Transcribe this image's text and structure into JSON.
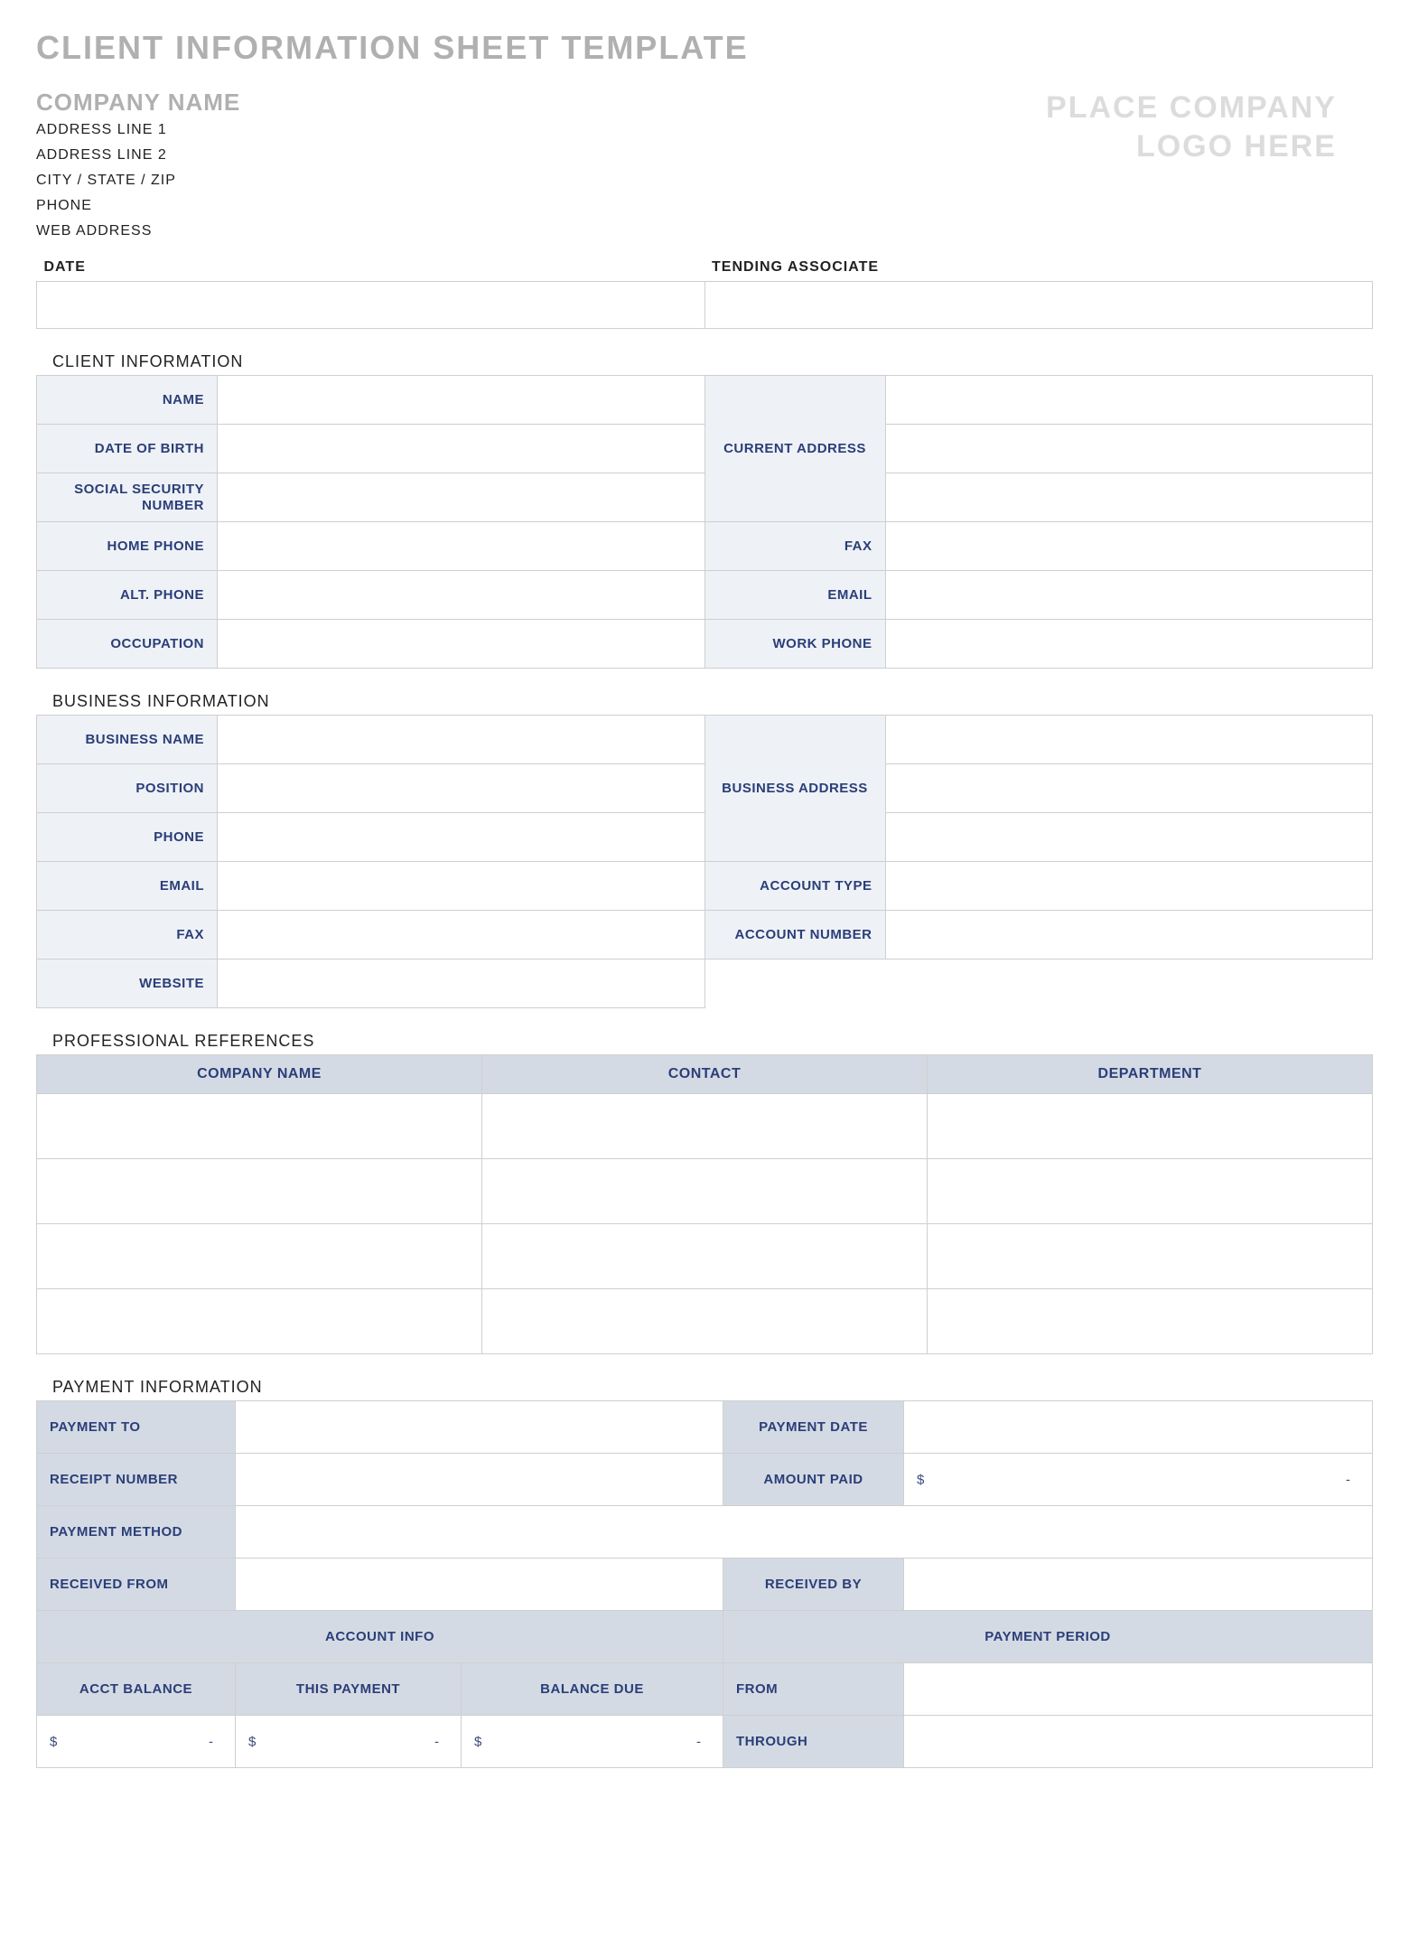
{
  "title": "CLIENT INFORMATION SHEET TEMPLATE",
  "company": {
    "name": "COMPANY NAME",
    "lines": [
      "ADDRESS LINE 1",
      "ADDRESS LINE 2",
      "CITY / STATE / ZIP",
      "PHONE",
      "WEB ADDRESS"
    ]
  },
  "logo_placeholder": {
    "line1": "PLACE COMPANY",
    "line2": "LOGO HERE"
  },
  "date_section": {
    "date_label": "DATE",
    "associate_label": "TENDING ASSOCIATE"
  },
  "client_info": {
    "section_label": "CLIENT INFORMATION",
    "labels": {
      "name": "NAME",
      "dob": "DATE OF BIRTH",
      "ssn": "SOCIAL SECURITY NUMBER",
      "home_phone": "HOME PHONE",
      "alt_phone": "ALT. PHONE",
      "occupation": "OCCUPATION",
      "current_address": "CURRENT ADDRESS",
      "fax": "FAX",
      "email": "EMAIL",
      "work_phone": "WORK PHONE"
    }
  },
  "business_info": {
    "section_label": "BUSINESS INFORMATION",
    "labels": {
      "business_name": "BUSINESS NAME",
      "position": "POSITION",
      "phone": "PHONE",
      "email": "EMAIL",
      "fax": "FAX",
      "website": "WEBSITE",
      "business_address": "BUSINESS ADDRESS",
      "account_type": "ACCOUNT TYPE",
      "account_number": "ACCOUNT NUMBER"
    }
  },
  "references": {
    "section_label": "PROFESSIONAL REFERENCES",
    "headers": [
      "COMPANY NAME",
      "CONTACT",
      "DEPARTMENT"
    ],
    "row_count": 4
  },
  "payment": {
    "section_label": "PAYMENT INFORMATION",
    "labels": {
      "payment_to": "PAYMENT TO",
      "payment_date": "PAYMENT DATE",
      "receipt_number": "RECEIPT NUMBER",
      "amount_paid": "AMOUNT PAID",
      "payment_method": "PAYMENT METHOD",
      "received_from": "RECEIVED FROM",
      "received_by": "RECEIVED BY",
      "account_info": "ACCOUNT INFO",
      "payment_period": "PAYMENT PERIOD",
      "acct_balance": "ACCT BALANCE",
      "this_payment": "THIS PAYMENT",
      "balance_due": "BALANCE DUE",
      "from": "FROM",
      "through": "THROUGH"
    },
    "currency_symbol": "$",
    "empty_dash": "-"
  }
}
